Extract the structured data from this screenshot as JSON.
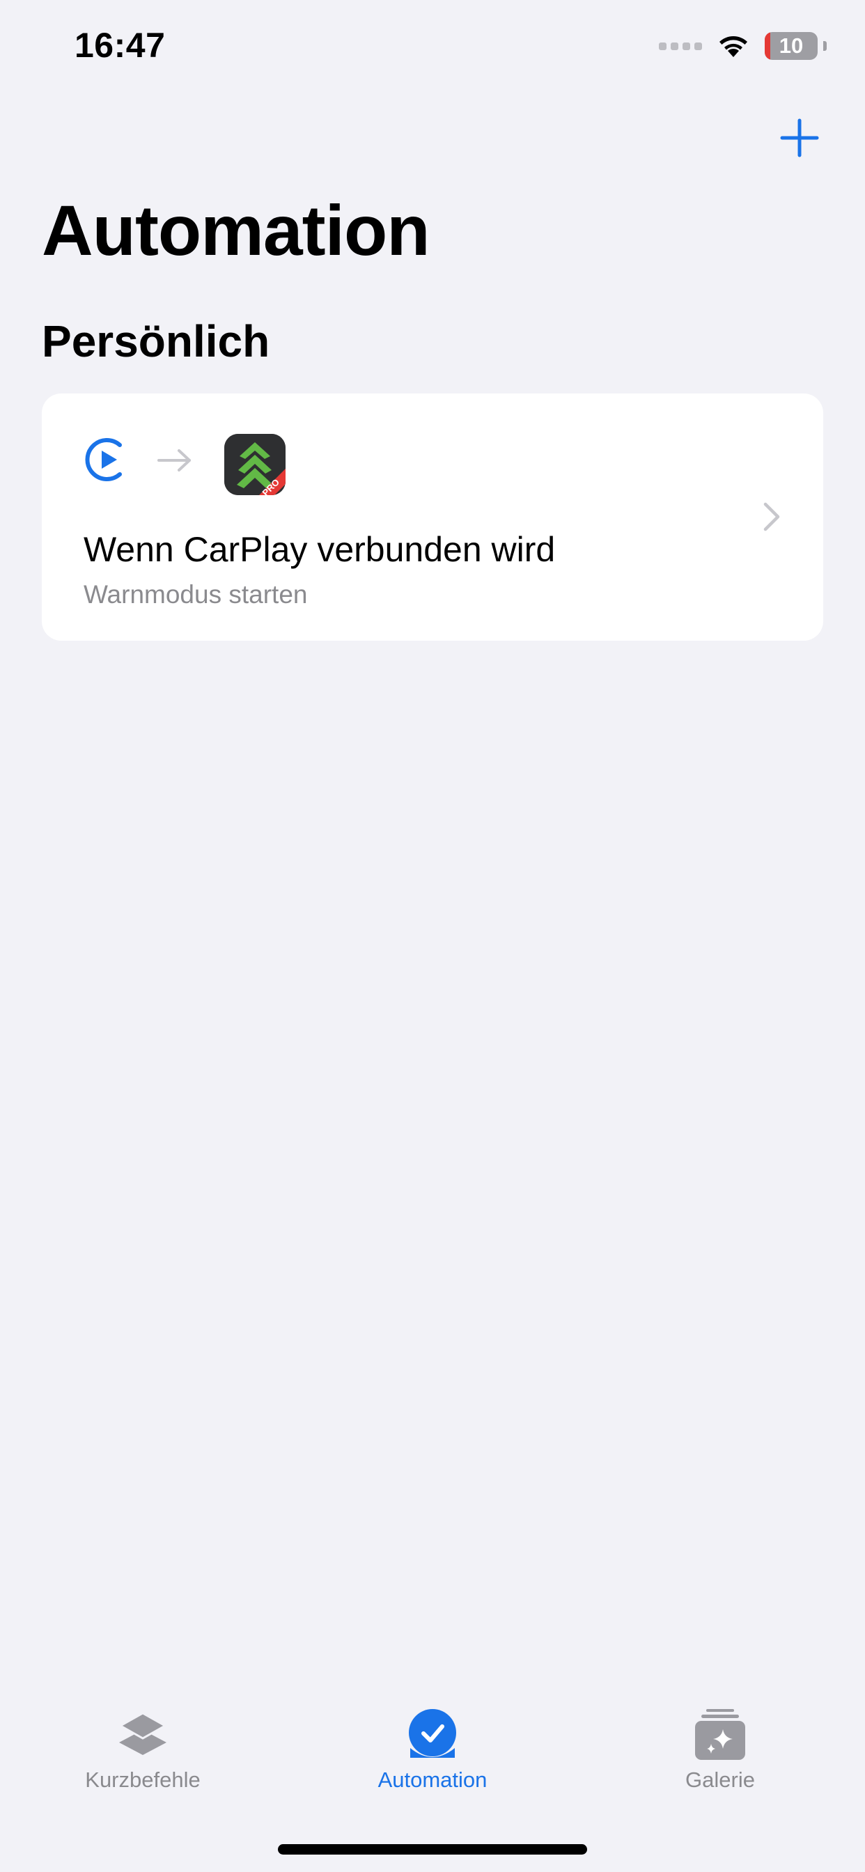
{
  "status_bar": {
    "time": "16:47",
    "battery_percent": "10",
    "battery_color": "#E53935",
    "icons": [
      "cellular-signal-icon",
      "wifi-icon",
      "battery-icon"
    ]
  },
  "header": {
    "add_icon": "plus-icon",
    "accent_color": "#1A73E8"
  },
  "page": {
    "title": "Automation",
    "section_title": "Persönlich"
  },
  "automations": [
    {
      "trigger_icon": "carplay-play-icon",
      "arrow_icon": "arrow-right-icon",
      "app_icon": "blitzer-pro-app-icon",
      "app_badge": "PRO",
      "title": "Wenn CarPlay verbunden wird",
      "subtitle": "Warnmodus starten"
    }
  ],
  "tab_bar": {
    "tabs": [
      {
        "label": "Kurzbefehle",
        "icon": "layers-icon",
        "active": false
      },
      {
        "label": "Automation",
        "icon": "clock-check-icon",
        "active": true
      },
      {
        "label": "Galerie",
        "icon": "gallery-sparkle-icon",
        "active": false
      }
    ]
  }
}
